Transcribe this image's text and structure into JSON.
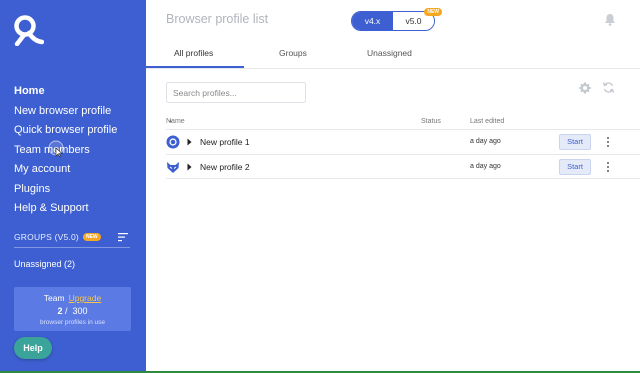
{
  "sidebar": {
    "nav": [
      {
        "label": "Home",
        "active": true
      },
      {
        "label": "New browser profile"
      },
      {
        "label": "Quick browser profile"
      },
      {
        "label": "Team members"
      },
      {
        "label": "My account"
      },
      {
        "label": "Plugins"
      },
      {
        "label": "Help & Support"
      }
    ],
    "groups_label": "GROUPS (V5.0)",
    "groups_badge": "NEW",
    "unassigned_label": "Unassigned (2)",
    "team": {
      "label": "Team",
      "upgrade_label": "Upgrade",
      "used": "2",
      "separator": "/",
      "total": "300",
      "caption": "browser profiles in use"
    },
    "help_label": "Help"
  },
  "header": {
    "title": "Browser profile list",
    "version_toggle": {
      "selected": "v4.x",
      "other": "v5.0",
      "badge": "NEW"
    }
  },
  "tabs": [
    {
      "label": "All profiles",
      "active": true
    },
    {
      "label": "Groups"
    },
    {
      "label": "Unassigned"
    }
  ],
  "search": {
    "placeholder": "Search profiles...",
    "value": ""
  },
  "table": {
    "columns": {
      "name": "Name",
      "status": "Status",
      "last_edited": "Last edited"
    },
    "rows": [
      {
        "icon": "orbita-browser-icon",
        "name": "New profile 1",
        "status": "",
        "edited": "a day ago",
        "action": "Start"
      },
      {
        "icon": "stealthfox-browser-icon",
        "name": "New profile 2",
        "status": "",
        "edited": "a day ago",
        "action": "Start"
      }
    ]
  },
  "colors": {
    "sidebar_bg": "#3d5fd1",
    "accent": "#3d5fd1",
    "badge": "#f5a623",
    "help_btn": "#3aa39a"
  }
}
